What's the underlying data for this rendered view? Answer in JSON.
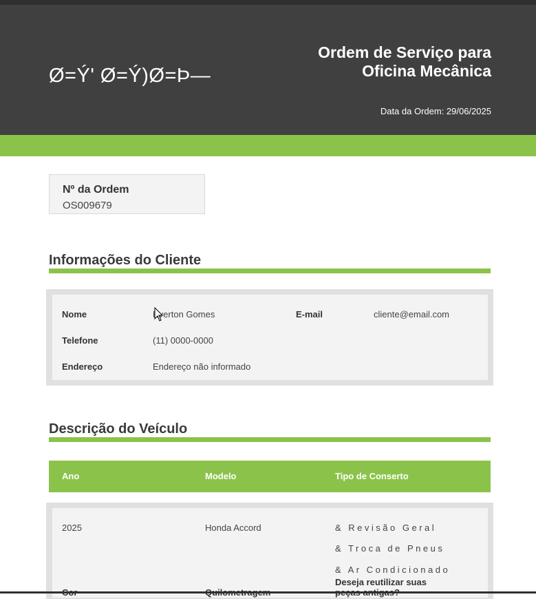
{
  "header": {
    "logo_text": "Ø=Ý' Ø=Ý)Ø=Þ—",
    "title_line1": "Ordem de Serviço para",
    "title_line2": "Oficina Mecânica",
    "date_text": "Data da Ordem: 29/06/2025"
  },
  "order": {
    "label": "Nº da Ordem",
    "value": "OS009679"
  },
  "client": {
    "section_title": "Informações do Cliente",
    "name_label": "Nome",
    "name_value": "Everton Gomes",
    "email_label": "E-mail",
    "email_value": "cliente@email.com",
    "phone_label": "Telefone",
    "phone_value": "(11) 0000-0000",
    "address_label": "Endereço",
    "address_value": "Endereço não informado"
  },
  "vehicle": {
    "section_title": "Descrição do Veículo",
    "col_year": "Ano",
    "col_model": "Modelo",
    "col_repair": "Tipo de Conserto",
    "year_value": "2025",
    "model_value": "Honda Accord",
    "repairs": [
      "& Revisão Geral",
      "& Troca de Pneus",
      "& Ar Condicionado"
    ],
    "color_label": "Cor",
    "mileage_label": "Quilometragem",
    "reuse_question_line1": "Deseja reutilizar suas",
    "reuse_question_line2": "peças antigas?"
  }
}
